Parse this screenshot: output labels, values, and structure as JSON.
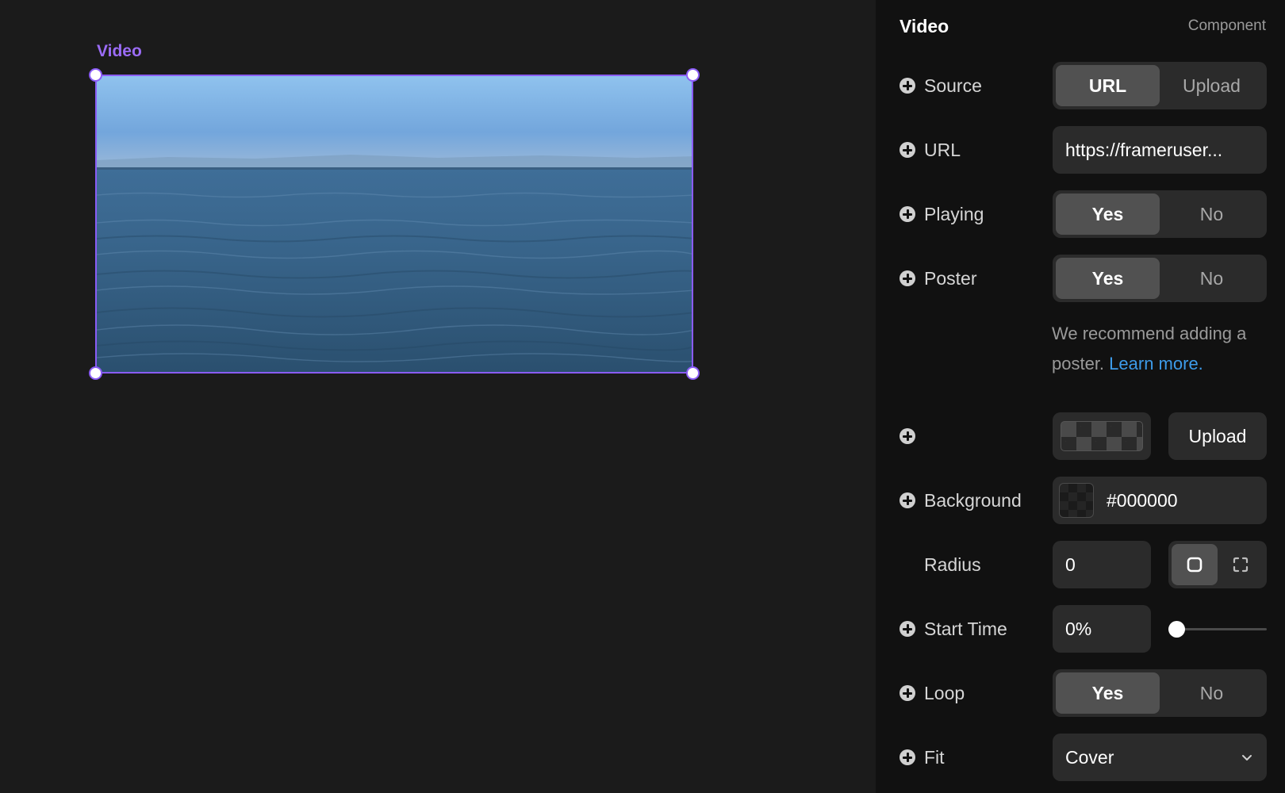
{
  "canvas": {
    "frame_label": "Video"
  },
  "panel": {
    "title": "Video",
    "subtitle": "Component",
    "source": {
      "label": "Source",
      "options": [
        "URL",
        "Upload"
      ],
      "selected": "URL"
    },
    "url": {
      "label": "URL",
      "value": "https://frameruser..."
    },
    "playing": {
      "label": "Playing",
      "options": [
        "Yes",
        "No"
      ],
      "selected": "Yes"
    },
    "poster": {
      "label": "Poster",
      "options": [
        "Yes",
        "No"
      ],
      "selected": "Yes"
    },
    "poster_note": {
      "text": "We recommend adding a poster.",
      "link": "Learn more."
    },
    "poster_image": {
      "upload_label": "Upload"
    },
    "background": {
      "label": "Background",
      "value": "#000000"
    },
    "radius": {
      "label": "Radius",
      "value": "0",
      "mode": "uniform"
    },
    "start_time": {
      "label": "Start Time",
      "value": "0%",
      "fraction": 0
    },
    "loop": {
      "label": "Loop",
      "options": [
        "Yes",
        "No"
      ],
      "selected": "Yes"
    },
    "fit": {
      "label": "Fit",
      "value": "Cover"
    }
  },
  "colors": {
    "selection": "#8a5cf5",
    "link": "#3d9be9",
    "panel_bg": "#111111",
    "canvas_bg": "#1b1b1b"
  },
  "icons": {
    "add": "plus-circle-icon",
    "radius_uniform": "square-corners-icon",
    "radius_individual": "corners-icon",
    "fit_dropdown": "chevron-down-icon"
  }
}
